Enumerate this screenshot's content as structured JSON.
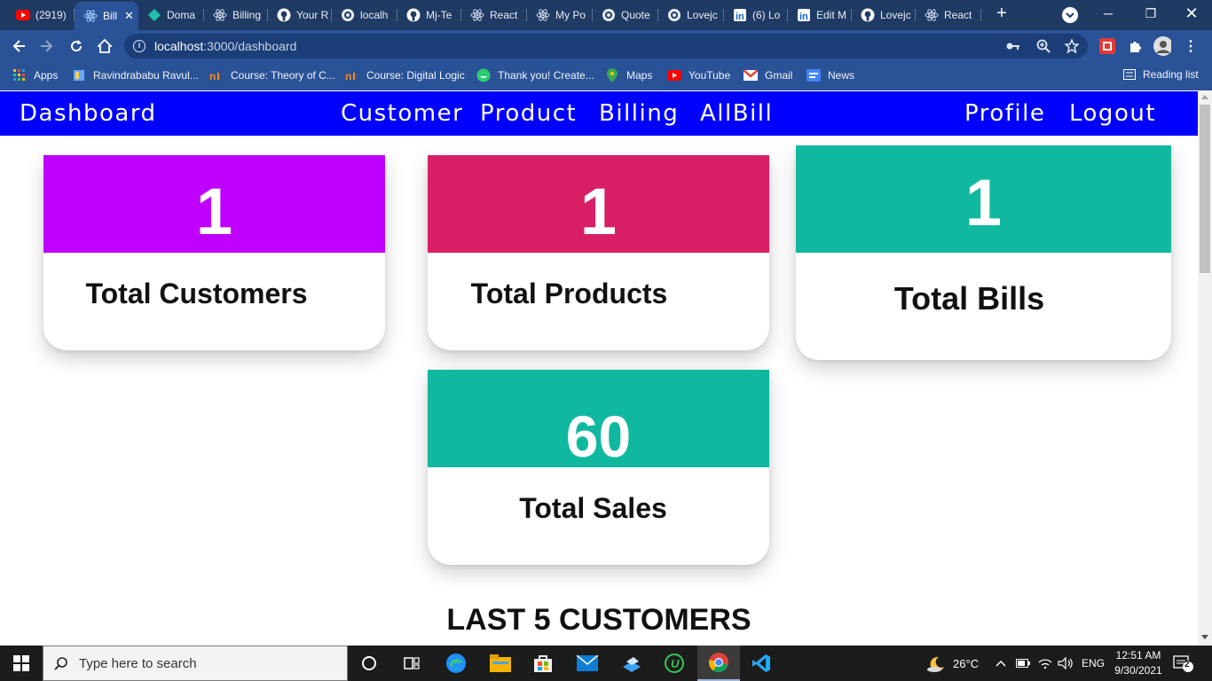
{
  "browser": {
    "tabs": [
      {
        "title": "(2919)",
        "icon": "youtube-icon"
      },
      {
        "title": "Bill",
        "icon": "react-icon",
        "active": true
      },
      {
        "title": "Doma",
        "icon": "diamond-icon"
      },
      {
        "title": "Billing",
        "icon": "react-icon"
      },
      {
        "title": "Your R",
        "icon": "github-icon"
      },
      {
        "title": "localh",
        "icon": "globe-icon"
      },
      {
        "title": "Mj-Te",
        "icon": "github-icon"
      },
      {
        "title": "React",
        "icon": "react-icon"
      },
      {
        "title": "My Po",
        "icon": "react-icon"
      },
      {
        "title": "Quote",
        "icon": "globe-icon"
      },
      {
        "title": "Lovejc",
        "icon": "globe-icon"
      },
      {
        "title": "(6) Lo",
        "icon": "linkedin-icon"
      },
      {
        "title": "Edit M",
        "icon": "linkedin-icon"
      },
      {
        "title": "Lovejc",
        "icon": "github-icon"
      },
      {
        "title": "React",
        "icon": "react-icon"
      }
    ],
    "url_host": "localhost",
    "url_path": ":3000/dashboard",
    "bookmarks": [
      {
        "label": "Apps",
        "icon": "apps-grid-icon"
      },
      {
        "label": "Ravindrababu Ravul...",
        "icon": "bookmark-icon"
      },
      {
        "label": "Course: Theory of C...",
        "icon": "course-icon"
      },
      {
        "label": "Course: Digital Logic",
        "icon": "course-icon"
      },
      {
        "label": "Thank you! Create...",
        "icon": "thank-you-icon"
      },
      {
        "label": "Maps",
        "icon": "maps-icon"
      },
      {
        "label": "YouTube",
        "icon": "youtube-icon"
      },
      {
        "label": "Gmail",
        "icon": "gmail-icon"
      },
      {
        "label": "News",
        "icon": "news-icon"
      }
    ],
    "reading_list": "Reading list"
  },
  "app": {
    "nav": {
      "brand": "Dashboard",
      "links": [
        "Customer",
        "Product",
        "Billing",
        "AllBill"
      ],
      "right": [
        "Profile",
        "Logout"
      ]
    },
    "cards": [
      {
        "value": "1",
        "label": "Total Customers",
        "color": "#bf00ff"
      },
      {
        "value": "1",
        "label": "Total Products",
        "color": "#d81f66"
      },
      {
        "value": "1",
        "label": "Total Bills",
        "color": "#11b8a0"
      },
      {
        "value": "60",
        "label": "Total Sales",
        "color": "#11b8a0"
      }
    ],
    "section_title": "LAST 5 CUSTOMERS"
  },
  "taskbar": {
    "search_placeholder": "Type here to search",
    "temperature": "26°C",
    "language": "ENG",
    "time": "12:51 AM",
    "date": "9/30/2021",
    "notifications": "2"
  }
}
